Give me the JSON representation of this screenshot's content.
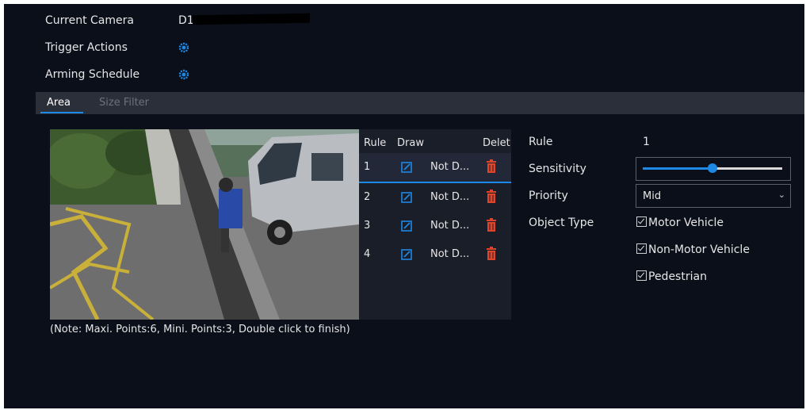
{
  "header": {
    "current_camera_label": "Current Camera",
    "current_camera_value": "D1",
    "trigger_actions_label": "Trigger Actions",
    "arming_schedule_label": "Arming Schedule"
  },
  "tabs": [
    {
      "label": "Area",
      "active": true
    },
    {
      "label": "Size Filter",
      "active": false
    }
  ],
  "rules_table": {
    "headers": {
      "rule": "Rule",
      "draw": "Draw",
      "delete": "Delet"
    },
    "rows": [
      {
        "num": "1",
        "status": "Not D...",
        "selected": true
      },
      {
        "num": "2",
        "status": "Not D...",
        "selected": false
      },
      {
        "num": "3",
        "status": "Not D...",
        "selected": false
      },
      {
        "num": "4",
        "status": "Not D...",
        "selected": false
      }
    ]
  },
  "settings": {
    "rule_label": "Rule",
    "rule_value": "1",
    "sensitivity_label": "Sensitivity",
    "sensitivity_level": 0.5,
    "priority_label": "Priority",
    "priority_value": "Mid",
    "object_type_label": "Object Type",
    "object_types": [
      {
        "label": "Motor Vehicle",
        "checked": true
      },
      {
        "label": "Non-Motor Vehicle",
        "checked": true
      },
      {
        "label": "Pedestrian",
        "checked": true
      }
    ]
  },
  "note": "(Note: Maxi. Points:6, Mini. Points:3, Double click to finish)",
  "colors": {
    "accent": "#1e88e5",
    "delete": "#e0452b",
    "background": "#0b0f1a"
  },
  "icons": {
    "trigger": "gear-icon",
    "schedule": "gear-icon",
    "draw": "edit-icon",
    "delete": "trash-icon"
  }
}
